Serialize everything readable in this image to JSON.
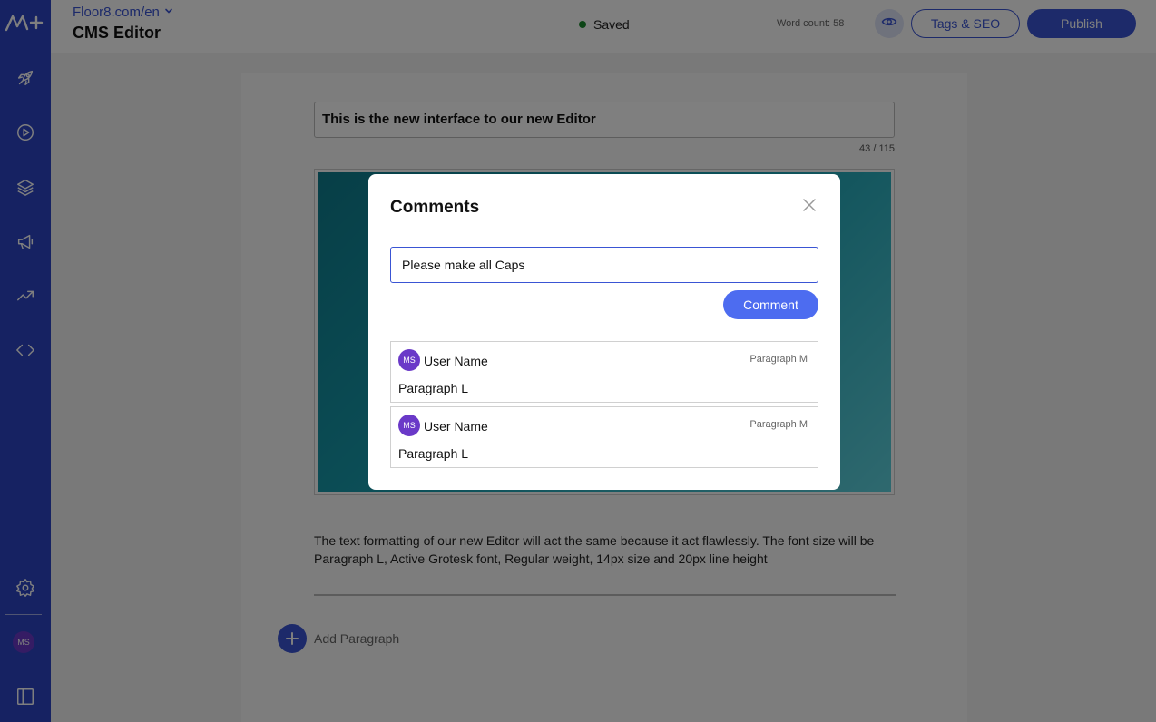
{
  "header": {
    "site": "Floor8.com/en",
    "title": "CMS Editor",
    "status": "Saved",
    "word_count": "Word count: 58",
    "tags_seo": "Tags & SEO",
    "publish": "Publish"
  },
  "sidebar": {
    "avatar_initials": "MS",
    "icons": [
      "logo-icon",
      "rocket-icon",
      "play-icon",
      "layers-icon",
      "megaphone-icon",
      "trending-icon",
      "code-icon",
      "gear-icon",
      "panel-icon"
    ]
  },
  "editor": {
    "title_value": "This is the new interface to our new Editor",
    "char_counter": "43 / 115",
    "body_text": "The text formatting of our new Editor will act the same because it act flawlessly. The font size will be Paragraph L, Active Grotesk font, Regular weight, 14px size and 20px line height",
    "add_paragraph": "Add Paragraph"
  },
  "modal": {
    "title": "Comments",
    "input_value": "Please make all Caps",
    "comment_button": "Comment",
    "comments": [
      {
        "initials": "MS",
        "user": "User Name",
        "tag": "Paragraph M",
        "text": "Paragraph L"
      },
      {
        "initials": "MS",
        "user": "User Name",
        "tag": "Paragraph M",
        "text": "Paragraph L"
      }
    ]
  },
  "colors": {
    "accent": "#3a55d4",
    "sidebar": "#2d45c4",
    "avatar": "#6a39c8",
    "saved_dot": "#1b8a2e"
  }
}
